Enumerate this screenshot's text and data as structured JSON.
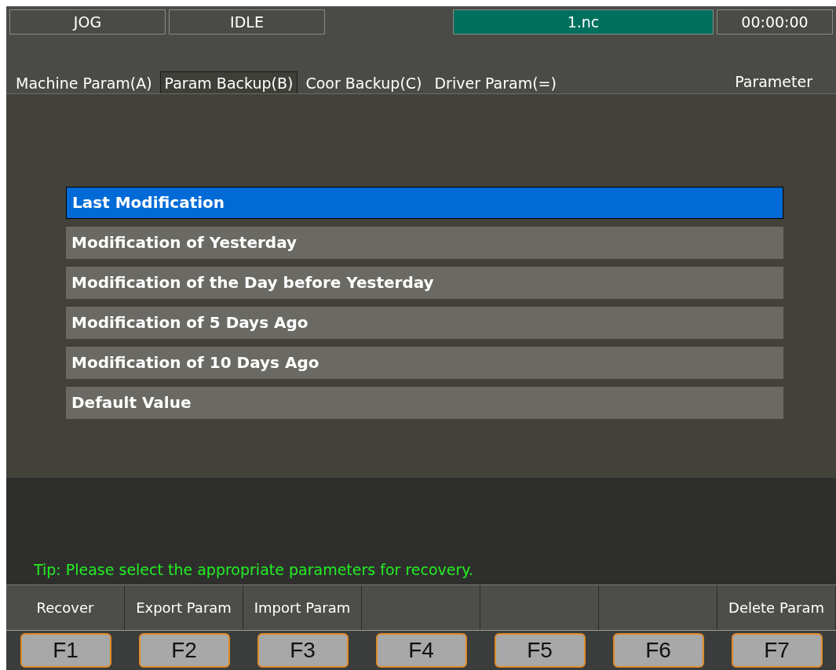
{
  "status_bar": {
    "mode": "JOG",
    "state": "IDLE",
    "file": "1.nc",
    "time": "00:00:00"
  },
  "tabs": [
    {
      "label": "Machine Param(A)",
      "selected": false
    },
    {
      "label": "Param Backup(B)",
      "selected": true
    },
    {
      "label": "Coor Backup(C)",
      "selected": false
    },
    {
      "label": "Driver Param(=)",
      "selected": false
    }
  ],
  "page_title": "Parameter",
  "backups": [
    {
      "label": "Last Modification",
      "selected": true
    },
    {
      "label": "Modification of Yesterday",
      "selected": false
    },
    {
      "label": "Modification of the Day before Yesterday",
      "selected": false
    },
    {
      "label": "Modification of 5 Days Ago",
      "selected": false
    },
    {
      "label": "Modification of 10 Days Ago",
      "selected": false
    },
    {
      "label": "Default Value",
      "selected": false
    }
  ],
  "tip": "Tip: Please select the appropriate parameters for recovery.",
  "softkeys": [
    {
      "label": "Recover",
      "key": "F1"
    },
    {
      "label": "Export Param",
      "key": "F2"
    },
    {
      "label": "Import Param",
      "key": "F3"
    },
    {
      "key": "F4"
    },
    {
      "key": "F5"
    },
    {
      "key": "F6"
    },
    {
      "label": "Delete Param",
      "key": "F7"
    }
  ]
}
